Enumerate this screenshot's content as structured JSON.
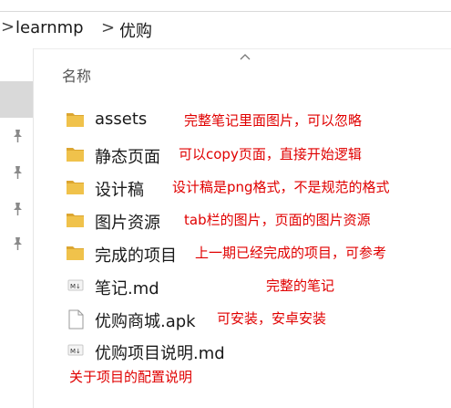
{
  "breadcrumb": {
    "items": [
      "learnmp",
      "优购"
    ],
    "separator": ">"
  },
  "column_header": "名称",
  "files": [
    {
      "name": "assets",
      "type": "folder",
      "note": "完整笔记里面图片，可以忽略"
    },
    {
      "name": "静态页面",
      "type": "folder",
      "note": "可以copy页面，直接开始逻辑"
    },
    {
      "name": "设计稿",
      "type": "folder",
      "note": "设计稿是png格式，不是规范的格式"
    },
    {
      "name": "图片资源",
      "type": "folder",
      "note": "tab栏的图片，页面的图片资源"
    },
    {
      "name": "完成的项目",
      "type": "folder",
      "note": "上一期已经完成的项目，可参考"
    },
    {
      "name": "笔记.md",
      "type": "markdown",
      "note": "完整的笔记"
    },
    {
      "name": "优购商城.apk",
      "type": "file",
      "note": "可安装，安卓安装"
    },
    {
      "name": "优购项目说明.md",
      "type": "markdown",
      "note": "关于项目的配置说明"
    }
  ],
  "colors": {
    "folder": "#f0c24b",
    "folder_dark": "#dca631",
    "note": "#e00000",
    "selection": "#d9d9d9"
  },
  "icons": {
    "folder": "folder-icon",
    "markdown": "markdown-file-icon",
    "file": "file-icon",
    "pin": "pin-icon"
  }
}
